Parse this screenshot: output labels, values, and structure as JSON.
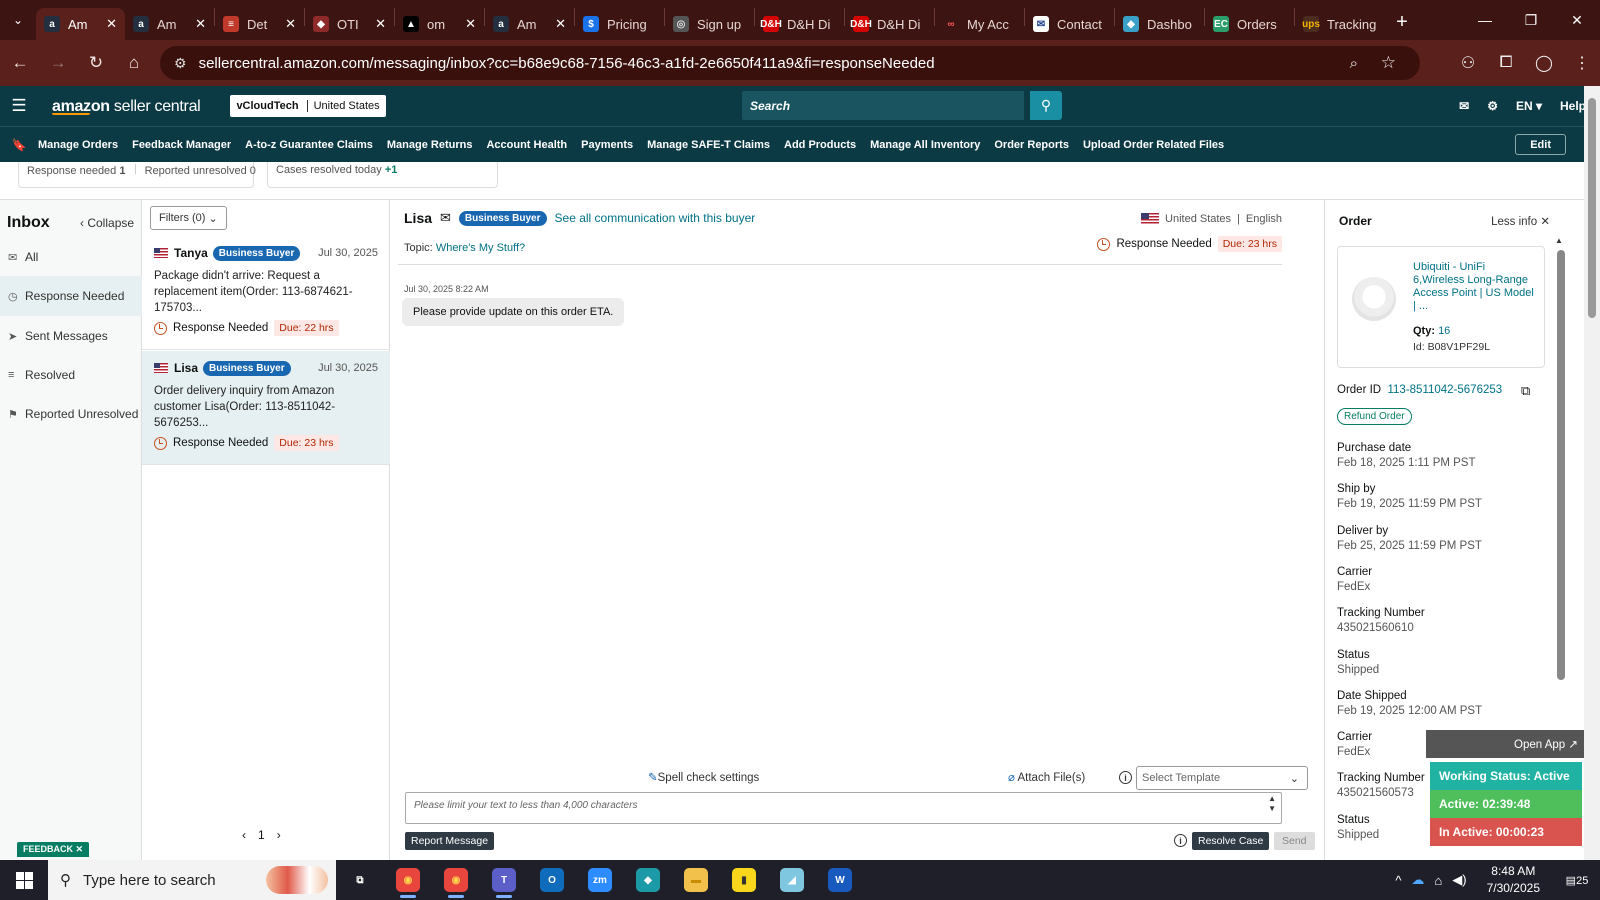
{
  "browser": {
    "tabs": [
      {
        "label": "Am",
        "icon": "amazon-icon",
        "fav": "a",
        "color": "#ffffff",
        "bg": "#232f3e",
        "active": true
      },
      {
        "label": "Am",
        "icon": "amazon-icon",
        "fav": "a",
        "color": "#ffffff",
        "bg": "#232f3e",
        "active": false
      },
      {
        "label": "Det",
        "icon": "deals-icon",
        "fav": "≡",
        "color": "#ffffff",
        "bg": "#c0392b",
        "active": false
      },
      {
        "label": "OTI",
        "icon": "oti-icon",
        "fav": "◆",
        "color": "#ffffff",
        "bg": "#8e2a2a",
        "active": false
      },
      {
        "label": "om",
        "icon": "om-icon",
        "fav": "▲",
        "color": "#ffffff",
        "bg": "#000000",
        "active": false
      },
      {
        "label": "Am",
        "icon": "amazon-icon",
        "fav": "a",
        "color": "#ffffff",
        "bg": "#232f3e",
        "active": false
      },
      {
        "label": "Pricing",
        "icon": "dollar-icon",
        "fav": "$",
        "color": "#ffffff",
        "bg": "#1a73e8",
        "active": false
      },
      {
        "label": "Sign up",
        "icon": "globe-icon",
        "fav": "◎",
        "color": "#dddddd",
        "bg": "#555555",
        "active": false
      },
      {
        "label": "D&H Di",
        "icon": "dh-icon",
        "fav": "D&H",
        "color": "#ffffff",
        "bg": "#d50000",
        "active": false
      },
      {
        "label": "D&H Di",
        "icon": "dh-icon",
        "fav": "D&H",
        "color": "#ffffff",
        "bg": "#d50000",
        "active": false
      },
      {
        "label": "My Acc",
        "icon": "account-icon",
        "fav": "∞",
        "color": "#ff5555",
        "bg": "#3c1512",
        "active": false
      },
      {
        "label": "Contact",
        "icon": "mail-icon",
        "fav": "✉",
        "color": "#1a3c8a",
        "bg": "#ffffff",
        "active": false
      },
      {
        "label": "Dashbo",
        "icon": "dashboard-icon",
        "fav": "◆",
        "color": "#ffffff",
        "bg": "#3aa0c8",
        "active": false
      },
      {
        "label": "Orders",
        "icon": "ec-icon",
        "fav": "EC",
        "color": "#ffffff",
        "bg": "#2a9d6a",
        "active": false
      },
      {
        "label": "Tracking",
        "icon": "ups-icon",
        "fav": "ups",
        "color": "#f6b400",
        "bg": "#4b2c1e",
        "active": false
      }
    ],
    "new_tab": "+",
    "url": "sellercentral.amazon.com/messaging/inbox?cc=b68e9c68-7156-46c3-a1fd-2e6650f411a9&fi=responseNeeded"
  },
  "header": {
    "logo_main": "amazon",
    "logo_sub": " seller central",
    "account_name": "vCloudTech",
    "marketplace": "United States",
    "search_placeholder": "Search",
    "language": "EN",
    "help": "Help"
  },
  "nav": {
    "links": [
      "Manage Orders",
      "Feedback Manager",
      "A-to-z Guarantee Claims",
      "Manage Returns",
      "Account Health",
      "Payments",
      "Manage SAFE-T Claims",
      "Add Products",
      "Manage All Inventory",
      "Order Reports",
      "Upload Order Related Files"
    ],
    "edit": "Edit"
  },
  "stats": {
    "response_needed_label": "Response needed",
    "response_needed_value": "1",
    "reported_unresolved_label": "Reported unresolved",
    "reported_unresolved_value": "0",
    "cases_resolved_label": "Cases resolved today",
    "cases_resolved_value": "+1"
  },
  "inbox": {
    "title": "Inbox",
    "collapse": "Collapse",
    "folders": [
      {
        "label": "All",
        "icon": "mail-icon",
        "glyph": "✉"
      },
      {
        "label": "Response Needed",
        "icon": "clock-icon",
        "glyph": "◷"
      },
      {
        "label": "Sent Messages",
        "icon": "send-icon",
        "glyph": "➤"
      },
      {
        "label": "Resolved",
        "icon": "resolved-icon",
        "glyph": "≡"
      },
      {
        "label": "Reported Unresolved",
        "icon": "reported-icon",
        "glyph": "⚑"
      }
    ]
  },
  "conversations": {
    "filters": "Filters (0)",
    "items": [
      {
        "name": "Tanya",
        "badge": "Business Buyer",
        "date": "Jul 30, 2025",
        "snippet": "Package didn't arrive: Request a replacement item(Order: 113-6874621-175703...",
        "status": "Response Needed",
        "due": "Due: 22 hrs"
      },
      {
        "name": "Lisa",
        "badge": "Business Buyer",
        "date": "Jul 30, 2025",
        "snippet": "Order delivery inquiry from Amazon customer Lisa(Order: 113-8511042-5676253...",
        "status": "Response Needed",
        "due": "Due: 23 hrs"
      }
    ],
    "page": "1"
  },
  "message": {
    "buyer": "Lisa",
    "badge": "Business Buyer",
    "see_all": "See all communication with this buyer",
    "topic_label": "Topic:",
    "topic": "Where's My Stuff?",
    "country": "United States",
    "language": "English",
    "status": "Response Needed",
    "due": "Due: 23 hrs",
    "timestamp": "Jul 30, 2025 8:22 AM",
    "body": "Please provide update on this order ETA.",
    "spell_check": "Spell check settings",
    "attach": "Attach File(s)",
    "template_placeholder": "Select Template",
    "textarea_placeholder": "Please limit your text to less than 4,000 characters",
    "report": "Report Message",
    "resolve": "Resolve Case",
    "send": "Send"
  },
  "order": {
    "title": "Order",
    "less_info": "Less info",
    "product_name": "Ubiquiti - UniFi 6,Wireless Long-Range Access Point | US Model | ...",
    "qty_label": "Qty:",
    "qty": "16",
    "product_id": "Id: B08V1PF29L",
    "order_id_label": "Order ID",
    "order_id": "113-8511042-5676253",
    "refund": "Refund Order",
    "fields": [
      {
        "label": "Purchase date",
        "value": "Feb 18, 2025 1:11 PM PST"
      },
      {
        "label": "Ship by",
        "value": "Feb 19, 2025 11:59 PM PST"
      },
      {
        "label": "Deliver by",
        "value": "Feb 25, 2025 11:59 PM PST"
      },
      {
        "label": "Carrier",
        "value": "FedEx"
      },
      {
        "label": "Tracking Number",
        "value": "435021560610"
      },
      {
        "label": "Status",
        "value": "Shipped"
      },
      {
        "label": "Date Shipped",
        "value": "Feb 19, 2025 12:00 AM PST"
      },
      {
        "label": "Carrier",
        "value": "FedEx"
      },
      {
        "label": "Tracking Number",
        "value": "435021560573"
      },
      {
        "label": "Status",
        "value": "Shipped"
      }
    ]
  },
  "widget": {
    "open_app": "Open App ↗",
    "working_status": "Working Status: Active",
    "active": "Active: 02:39:48",
    "inactive": "In Active: 00:00:23"
  },
  "feedback": "FEEDBACK ✕",
  "taskbar": {
    "search": "Type here to search",
    "apps": [
      {
        "icon": "task-view-icon",
        "glyph": "⧉",
        "bg": "transparent",
        "color": "#ffffff"
      },
      {
        "icon": "chrome-icon",
        "glyph": "◉",
        "bg": "#e8453c",
        "color": "#ffd04b"
      },
      {
        "icon": "chrome-profile-icon",
        "glyph": "◉",
        "bg": "#e8453c",
        "color": "#ffd04b"
      },
      {
        "icon": "teams-icon",
        "glyph": "T",
        "bg": "#5b5fc7",
        "color": "#ffffff"
      },
      {
        "icon": "outlook-icon",
        "glyph": "O",
        "bg": "#0f6cbd",
        "color": "#ffffff"
      },
      {
        "icon": "zoom-icon",
        "glyph": "zm",
        "bg": "#2d8cff",
        "color": "#ffffff"
      },
      {
        "icon": "app-icon",
        "glyph": "◆",
        "bg": "#1c9aa8",
        "color": "#ffffff"
      },
      {
        "icon": "file-explorer-icon",
        "glyph": "▬",
        "bg": "#f2c14b",
        "color": "#c98a00"
      },
      {
        "icon": "sticky-notes-icon",
        "glyph": "▮",
        "bg": "#f9d71c",
        "color": "#333333"
      },
      {
        "icon": "snip-icon",
        "glyph": "◢",
        "bg": "#7fc6e0",
        "color": "#ffffff"
      },
      {
        "icon": "word-icon",
        "glyph": "W",
        "bg": "#185abd",
        "color": "#ffffff"
      }
    ],
    "time": "8:48 AM",
    "date": "7/30/2025",
    "notifications": "25"
  }
}
